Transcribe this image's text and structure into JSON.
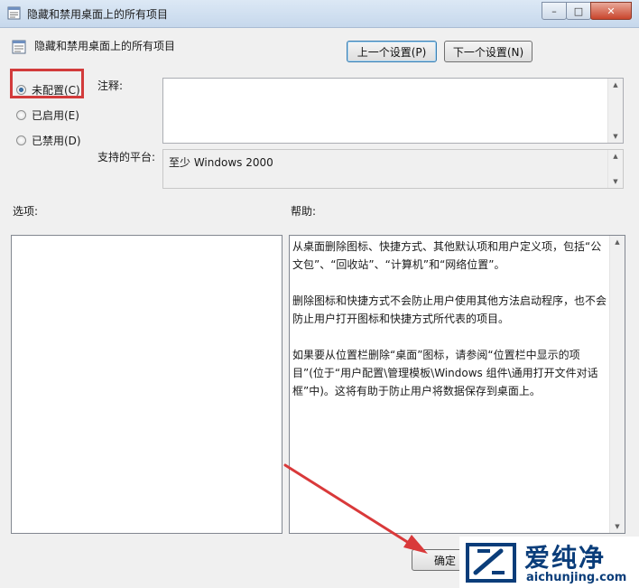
{
  "window": {
    "title": "隐藏和禁用桌面上的所有项目",
    "controls": {
      "minimize": "–",
      "maximize": "□",
      "close": "✕"
    }
  },
  "header": {
    "title": "隐藏和禁用桌面上的所有项目",
    "prev_button": "上一个设置(P)",
    "next_button": "下一个设置(N)"
  },
  "radios": {
    "not_configured": "未配置(C)",
    "enabled": "已启用(E)",
    "disabled": "已禁用(D)",
    "selected": "not_configured"
  },
  "fields": {
    "comment_label": "注释:",
    "comment_value": "",
    "platform_label": "支持的平台:",
    "platform_value": "至少 Windows 2000"
  },
  "sections": {
    "options_label": "选项:",
    "help_label": "帮助:"
  },
  "help": {
    "paragraphs": [
      "从桌面删除图标、快捷方式、其他默认项和用户定义项，包括“公文包”、“回收站”、“计算机”和“网络位置”。",
      "删除图标和快捷方式不会防止用户使用其他方法启动程序，也不会防止用户打开图标和快捷方式所代表的项目。",
      "如果要从位置栏删除“桌面”图标，请参阅“位置栏中显示的项目”(位于“用户配置\\管理模板\\Windows 组件\\通用打开文件对话框”中)。这将有助于防止用户将数据保存到桌面上。"
    ]
  },
  "footer": {
    "ok_button": "确定"
  },
  "watermark": {
    "brand": "爱纯净",
    "url": "aichunjing.com"
  },
  "colors": {
    "highlight": "#d23b3b",
    "arrow": "#d9393a",
    "brand": "#0a3d7a"
  },
  "icons": {
    "title": "policy-settings-icon",
    "header": "policy-settings-icon"
  }
}
